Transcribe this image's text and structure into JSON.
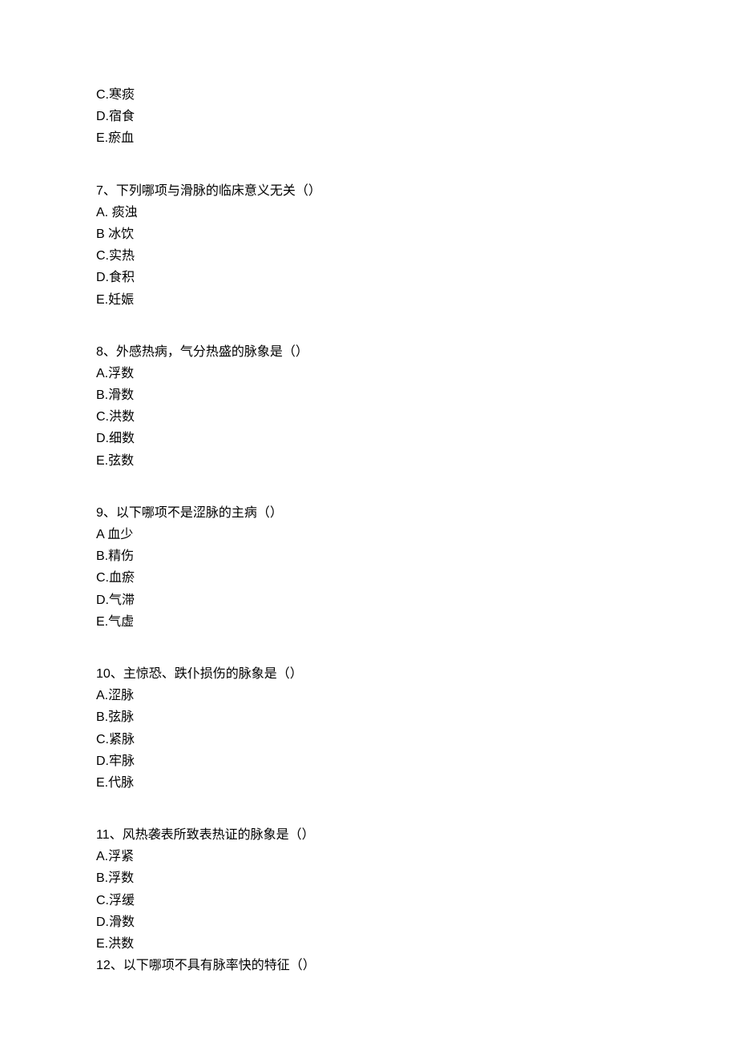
{
  "q6_tail": {
    "C": "C.寒痰",
    "D": "D.宿食",
    "E": "E.瘀血"
  },
  "q7": {
    "stem": "7、下列哪项与滑脉的临床意义无关（）",
    "A": "A. 痰浊",
    "B": "B 冰饮",
    "C": "C.实热",
    "D": "D.食积",
    "E": "E.妊娠"
  },
  "q8": {
    "stem": "8、外感热病，气分热盛的脉象是（）",
    "A": "A.浮数",
    "B": "B.滑数",
    "C": "C.洪数",
    "D": "D.细数",
    "E": "E.弦数"
  },
  "q9": {
    "stem": "9、以下哪项不是涩脉的主病（）",
    "A": "A 血少",
    "B": "B.精伤",
    "C": "C.血瘀",
    "D": "D.气滞",
    "E": "E.气虚"
  },
  "q10": {
    "stem": "10、主惊恐、跌仆损伤的脉象是（）",
    "A": "A.涩脉",
    "B": "B.弦脉",
    "C": "C.紧脉",
    "D": "D.牢脉",
    "E": "E.代脉"
  },
  "q11": {
    "stem": "11、风热袭表所致表热证的脉象是（）",
    "A": "A.浮紧",
    "B": "B.浮数",
    "C": "C.浮缓",
    "D": "D.滑数",
    "E": "E.洪数"
  },
  "q12": {
    "stem": "12、以下哪项不具有脉率快的特征（）"
  }
}
